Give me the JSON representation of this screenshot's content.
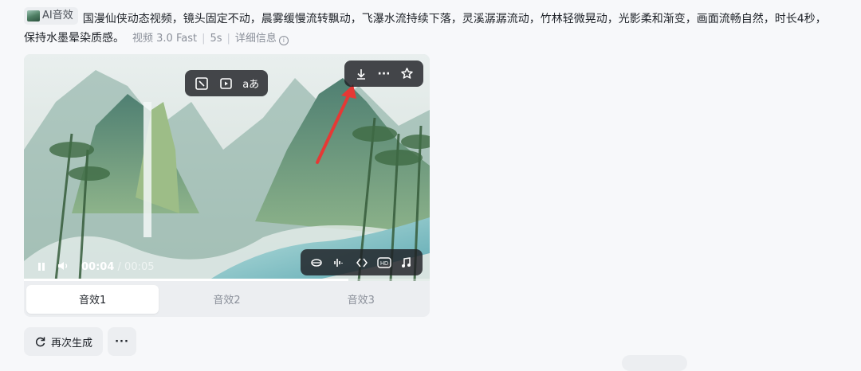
{
  "prompt": {
    "badge_label": "AI音效",
    "text": "国漫仙侠动态视频，镜头固定不动，晨雾缓慢流转飘动，飞瀑水流持续下落，灵溪潺潺流动，竹林轻微晃动，光影柔和渐变，画面流畅自然，时长4秒，保持水墨晕染质感。",
    "model": "视频 3.0 Fast",
    "duration": "5s",
    "details_label": "详细信息"
  },
  "video": {
    "current_time": "00:04",
    "separator": " / ",
    "total_time": "00:05",
    "progress": 0.8,
    "top_center_tools": [
      "crop-icon",
      "play-sparkle-icon",
      "translate-icon"
    ],
    "top_right_tools": [
      "download-icon",
      "more-icon",
      "star-icon"
    ],
    "bottom_right_tools": [
      "lip-sync-icon",
      "audio-wave-icon",
      "interpolate-icon",
      "hd-icon",
      "music-icon"
    ],
    "arrow_color": "#e53935"
  },
  "tabs": [
    {
      "label": "音效1",
      "active": true
    },
    {
      "label": "音效2",
      "active": false
    },
    {
      "label": "音效3",
      "active": false
    }
  ],
  "actions": {
    "regenerate_label": "再次生成",
    "more_label": "···"
  }
}
